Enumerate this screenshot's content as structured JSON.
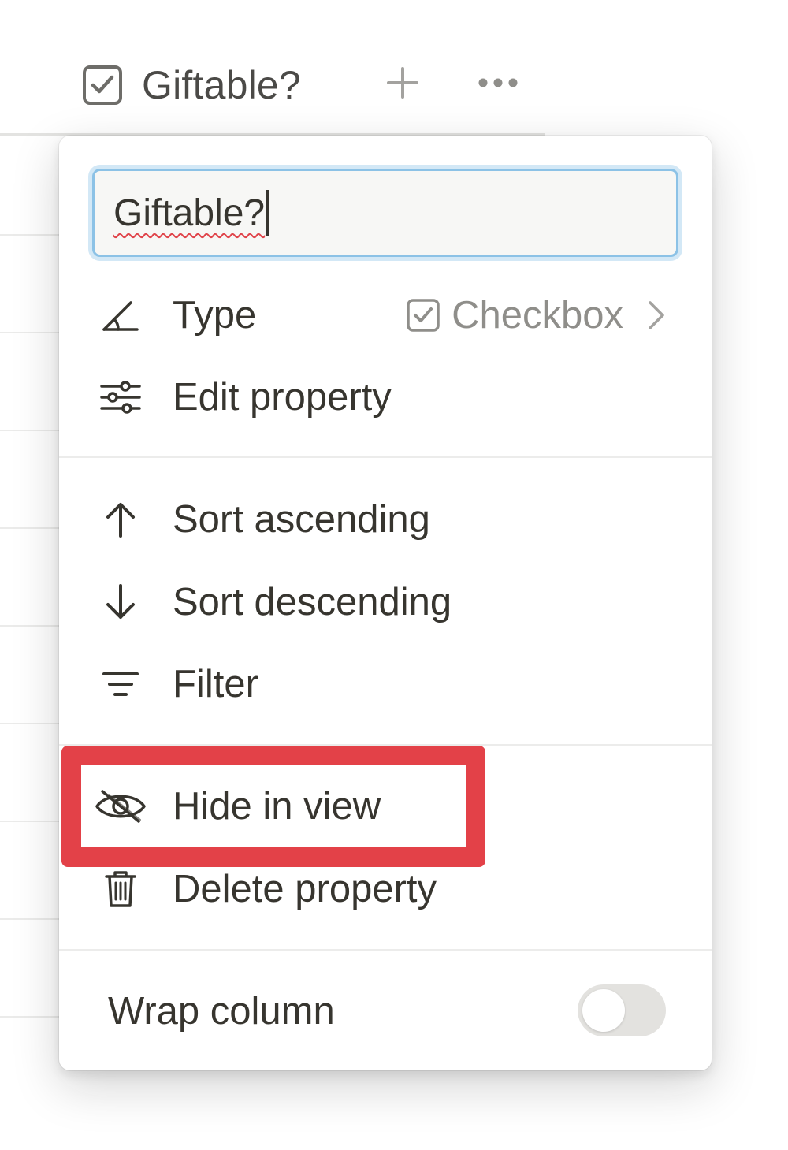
{
  "header": {
    "column_title": "Giftable?",
    "checkbox_icon": "checkbox-icon",
    "add_icon": "plus-icon",
    "more_icon": "ellipsis-icon"
  },
  "menu": {
    "name_input_value": "Giftable?",
    "type_item": {
      "label": "Type",
      "icon": "type-pen-icon",
      "value": "Checkbox",
      "value_icon": "checkbox-icon",
      "chevron_icon": "chevron-right-icon"
    },
    "edit_property": {
      "label": "Edit property",
      "icon": "sliders-icon"
    },
    "sort_ascending": {
      "label": "Sort ascending",
      "icon": "arrow-up-icon"
    },
    "sort_descending": {
      "label": "Sort descending",
      "icon": "arrow-down-icon"
    },
    "filter": {
      "label": "Filter",
      "icon": "filter-lines-icon"
    },
    "hide_in_view": {
      "label": "Hide in view",
      "icon": "eye-off-icon"
    },
    "delete_property": {
      "label": "Delete property",
      "icon": "trash-icon"
    },
    "wrap_column": {
      "label": "Wrap column",
      "toggle_on": false
    }
  },
  "colors": {
    "highlight": "#e34148",
    "input_focus": "#8cc2e6",
    "text_primary": "#37352f",
    "text_muted": "#8f8e8a"
  }
}
